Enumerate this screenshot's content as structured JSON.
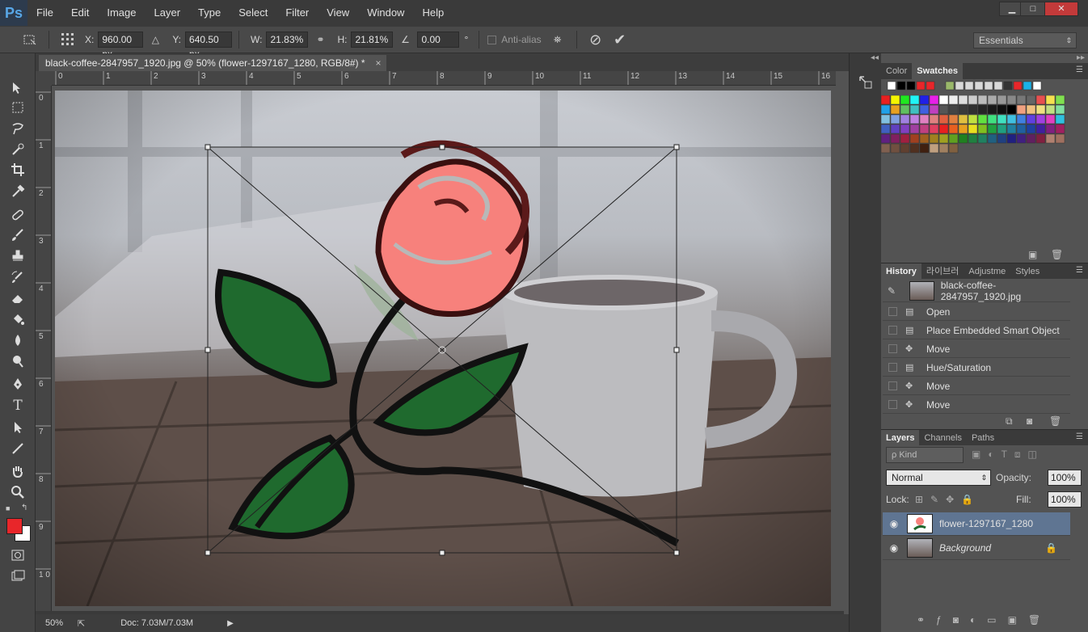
{
  "app": {
    "logo": "Ps"
  },
  "menu": [
    "File",
    "Edit",
    "Image",
    "Layer",
    "Type",
    "Select",
    "Filter",
    "View",
    "Window",
    "Help"
  ],
  "window_buttons": {
    "minimize": "▁",
    "maximize": "□",
    "close": "✕"
  },
  "options": {
    "x_label": "X:",
    "x_value": "960.00 px",
    "y_label": "Y:",
    "y_value": "640.50 px",
    "w_label": "W:",
    "w_value": "21.83%",
    "h_label": "H:",
    "h_value": "21.81%",
    "angle_value": "0.00",
    "angle_unit": "°",
    "antialias_label": "Anti-alias",
    "workspace": "Essentials"
  },
  "document": {
    "tab_title": "black-coffee-2847957_1920.jpg @ 50% (flower-1297167_1280, RGB/8#) *",
    "ruler_h": [
      "0",
      "1",
      "2",
      "3",
      "4",
      "5",
      "6",
      "7",
      "8",
      "9",
      "10",
      "11",
      "12",
      "13",
      "14",
      "15",
      "16"
    ],
    "ruler_v": [
      "0",
      "1",
      "2",
      "3",
      "4",
      "5",
      "6",
      "7",
      "8",
      "9",
      "1 0"
    ]
  },
  "status": {
    "zoom": "50%",
    "doc": "Doc: 7.03M/7.03M"
  },
  "colors": {
    "foreground": "#e8262a",
    "background": "#ffffff",
    "accent": "#5f7592"
  },
  "swatches_panel": {
    "tabs": [
      "Color",
      "Swatches"
    ],
    "active": "Swatches"
  },
  "history_panel": {
    "tabs": [
      "History",
      "라이브러",
      "Adjustme",
      "Styles"
    ],
    "snapshot": "black-coffee-2847957_1920.jpg",
    "states": [
      {
        "label": "Open",
        "icon": "doc-icon"
      },
      {
        "label": "Place Embedded Smart Object",
        "icon": "doc-icon"
      },
      {
        "label": "Move",
        "icon": "move-icon"
      },
      {
        "label": "Hue/Saturation",
        "icon": "doc-icon"
      },
      {
        "label": "Move",
        "icon": "move-icon"
      },
      {
        "label": "Move",
        "icon": "move-icon"
      }
    ]
  },
  "layers_panel": {
    "tabs": [
      "Layers",
      "Channels",
      "Paths"
    ],
    "filter_label": "ρ Kind",
    "blend_mode": "Normal",
    "opacity_label": "Opacity:",
    "opacity_value": "100%",
    "lock_label": "Lock:",
    "fill_label": "Fill:",
    "fill_value": "100%",
    "layers": [
      {
        "name": "flower-1297167_1280",
        "selected": true
      },
      {
        "name": "Background",
        "selected": false,
        "locked": true
      }
    ]
  }
}
